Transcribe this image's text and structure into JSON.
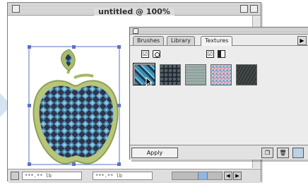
{
  "document_window": {
    "title": "untitled @ 100%",
    "status": {
      "field_1": "***.** lb",
      "field_2": "***.** lb"
    }
  },
  "panel": {
    "tabs": [
      {
        "label": "Brushes",
        "active": false
      },
      {
        "label": "Library",
        "active": false
      },
      {
        "label": "Textures",
        "active": true
      }
    ],
    "options_row": {
      "left_checkbox": "☑",
      "right_checkbox": "☑"
    },
    "swatches": [
      {
        "name": "blue-patterned-texture",
        "color": "#2c6d86",
        "selected": true
      },
      {
        "name": "dark-stone-texture",
        "color": "#222b33"
      },
      {
        "name": "gray-fabric-texture",
        "color": "#8fa19e"
      },
      {
        "name": "pink-blue-speckle-texture",
        "color": "#c9c0c9"
      },
      {
        "name": "dark-grain-texture",
        "color": "#303535"
      }
    ],
    "footer": {
      "apply_label": "Apply",
      "new_icon": "new-page-icon",
      "trash_icon": "trash-icon"
    }
  },
  "artwork": {
    "subject": "apple-with-blue-weave-texture",
    "fill_color": "#3b7fa0",
    "outline_color": "#a6b86a"
  }
}
